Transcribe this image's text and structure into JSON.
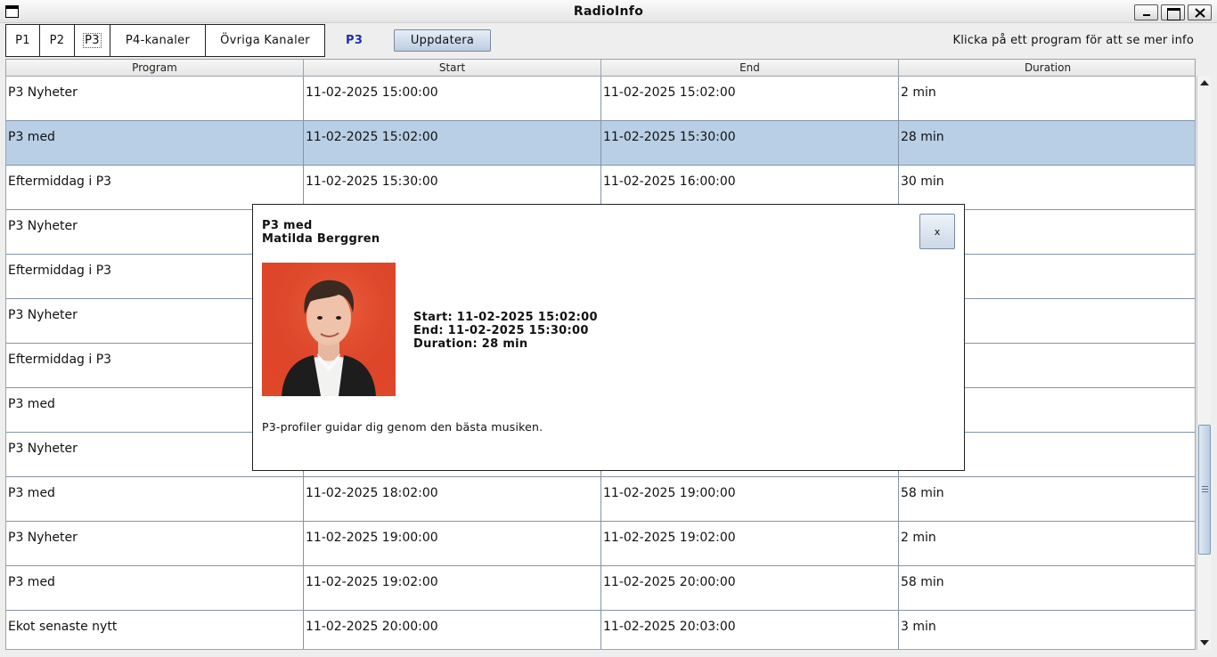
{
  "window": {
    "title": "RadioInfo"
  },
  "toolbar": {
    "tabs": [
      "P1",
      "P2",
      "P3",
      "P4-kanaler",
      "Övriga Kanaler"
    ],
    "current_channel": "P3",
    "update_label": "Uppdatera",
    "hint": "Klicka på ett program för att se mer info",
    "current_channel_color": "#1a2fb5"
  },
  "table": {
    "headers": [
      "Program",
      "Start",
      "End",
      "Duration"
    ],
    "selected_row_color": "#b8cfe5",
    "rows": [
      [
        "P3 Nyheter",
        "11-02-2025 15:00:00",
        "11-02-2025 15:02:00",
        "2 min"
      ],
      [
        "P3 med",
        "11-02-2025 15:02:00",
        "11-02-2025 15:30:00",
        "28 min"
      ],
      [
        "Eftermiddag i P3",
        "11-02-2025 15:30:00",
        "11-02-2025 16:00:00",
        "30 min"
      ],
      [
        "P3 Nyheter",
        "",
        "",
        ""
      ],
      [
        "Eftermiddag i P3",
        "",
        "",
        ""
      ],
      [
        "P3 Nyheter",
        "",
        "",
        ""
      ],
      [
        "Eftermiddag i P3",
        "",
        "",
        ""
      ],
      [
        "P3 med",
        "",
        "",
        ""
      ],
      [
        "P3 Nyheter",
        "",
        "",
        ""
      ],
      [
        "P3 med",
        "11-02-2025 18:02:00",
        "11-02-2025 19:00:00",
        "58 min"
      ],
      [
        "P3 Nyheter",
        "11-02-2025 19:00:00",
        "11-02-2025 19:02:00",
        "2 min"
      ],
      [
        "P3 med",
        "11-02-2025 19:02:00",
        "11-02-2025 20:00:00",
        "58 min"
      ],
      [
        "Ekot senaste nytt",
        "11-02-2025 20:00:00",
        "11-02-2025 20:03:00",
        "3 min"
      ]
    ]
  },
  "popup": {
    "program": "P3 med",
    "host": "Matilda Berggren",
    "close_label": "x",
    "start": "Start: 11-02-2025 15:02:00",
    "end": "End: 11-02-2025 15:30:00",
    "duration": "Duration: 28 min",
    "description": "P3-profiler guidar dig genom den bästa musiken.",
    "photo_background": "#e0462a"
  }
}
